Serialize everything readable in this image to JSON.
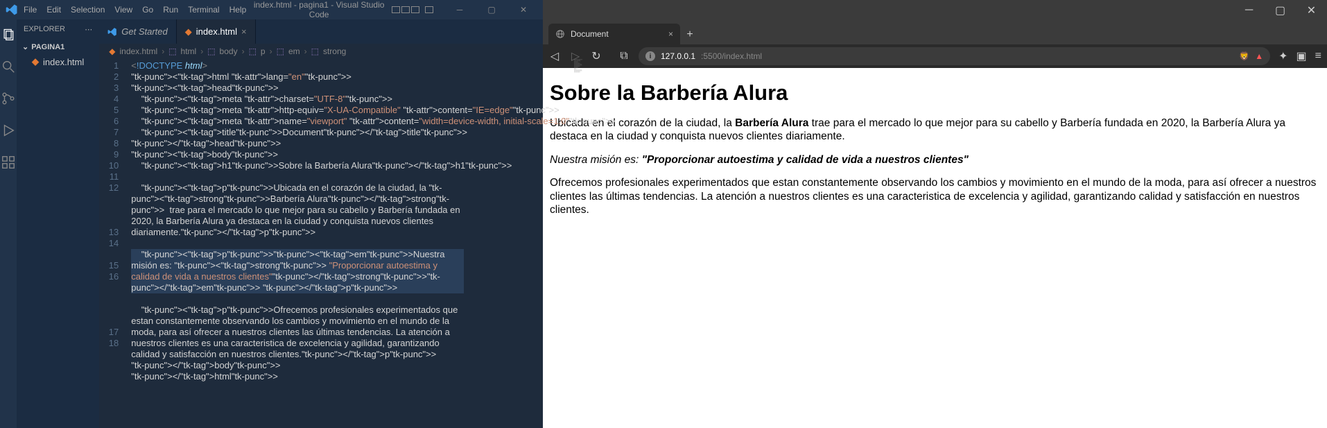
{
  "vscode": {
    "menu": [
      "File",
      "Edit",
      "Selection",
      "View",
      "Go",
      "Run",
      "Terminal",
      "Help"
    ],
    "title": "index.html - pagina1 - Visual Studio Code",
    "sidebar": {
      "header": "EXPLORER",
      "section": "PAGINA1",
      "file": "index.html"
    },
    "tabs": {
      "getstarted": "Get Started",
      "indexhtml": "index.html"
    },
    "breadcrumbs": [
      "index.html",
      "html",
      "body",
      "p",
      "em",
      "strong"
    ],
    "line_numbers": [
      "1",
      "2",
      "3",
      "4",
      "5",
      "6",
      "7",
      "8",
      "9",
      "10",
      "11",
      "12",
      "",
      "",
      "",
      "13",
      "14",
      "",
      "15",
      "16",
      "",
      "",
      "",
      "",
      "17",
      "18"
    ],
    "code": {
      "l1_doctype": "<!DOCTYPE",
      "l1_html": " html",
      "l1_end": ">",
      "l2": "<html lang=\"en\">",
      "l3": "<head>",
      "l4": "    <meta charset=\"UTF-8\">",
      "l5": "    <meta http-equiv=\"X-UA-Compatible\" content=\"IE=edge\">",
      "l6": "    <meta name=\"viewport\" content=\"width=device-width, initial-scale=1.0\">",
      "l7": "    <title>Document</title>",
      "l8": "</head>",
      "l9": "<body>",
      "l10": "    <h1>Sobre la Barbería Alura</h1>",
      "l11": "",
      "l12": "    <p>Ubicada en el corazón de la ciudad, la <strong>Barbería Alura</strong>  trae para el mercado lo que mejor para su cabello y Barbería fundada en 2020, la Barbería Alura ya destaca en la ciudad y conquista nuevos clientes diariamente.</p>",
      "l13": "",
      "l14": "    <p><em>Nuestra misión es: <strong> \"Proporcionar autoestima y calidad de vida a nuestros clientes\"</strong></em> </p>",
      "l15": "",
      "l16": "    <p>Ofrecemos profesionales experimentados que estan constantemente observando los cambios y movimiento en el mundo de la moda, para así ofrecer a nuestros clientes las últimas tendencias. La atención a nuestros clientes es una caracteristica de excelencia y agilidad, garantizando calidad y satisfacción en nuestros clientes.</p>",
      "l17": "</body>",
      "l18": "</html>"
    }
  },
  "browser": {
    "tab_title": "Document",
    "url_host": "127.0.0.1",
    "url_rest": ":5500/index.html",
    "page": {
      "h1": "Sobre la Barbería Alura",
      "p1_a": "Ubicada en el corazón de la ciudad, la ",
      "p1_strong": "Barbería Alura",
      "p1_b": " trae para el mercado lo que mejor para su cabello y Barbería fundada en 2020, la Barbería Alura ya destaca en la ciudad y conquista nuevos clientes diariamente.",
      "p2_a": "Nuestra misión es: ",
      "p2_strong": "\"Proporcionar autoestima y calidad de vida a nuestros clientes\"",
      "p3": "Ofrecemos profesionales experimentados que estan constantemente observando los cambios y movimiento en el mundo de la moda, para así ofrecer a nuestros clientes las últimas tendencias. La atención a nuestros clientes es una caracteristica de excelencia y agilidad, garantizando calidad y satisfacción en nuestros clientes."
    }
  }
}
